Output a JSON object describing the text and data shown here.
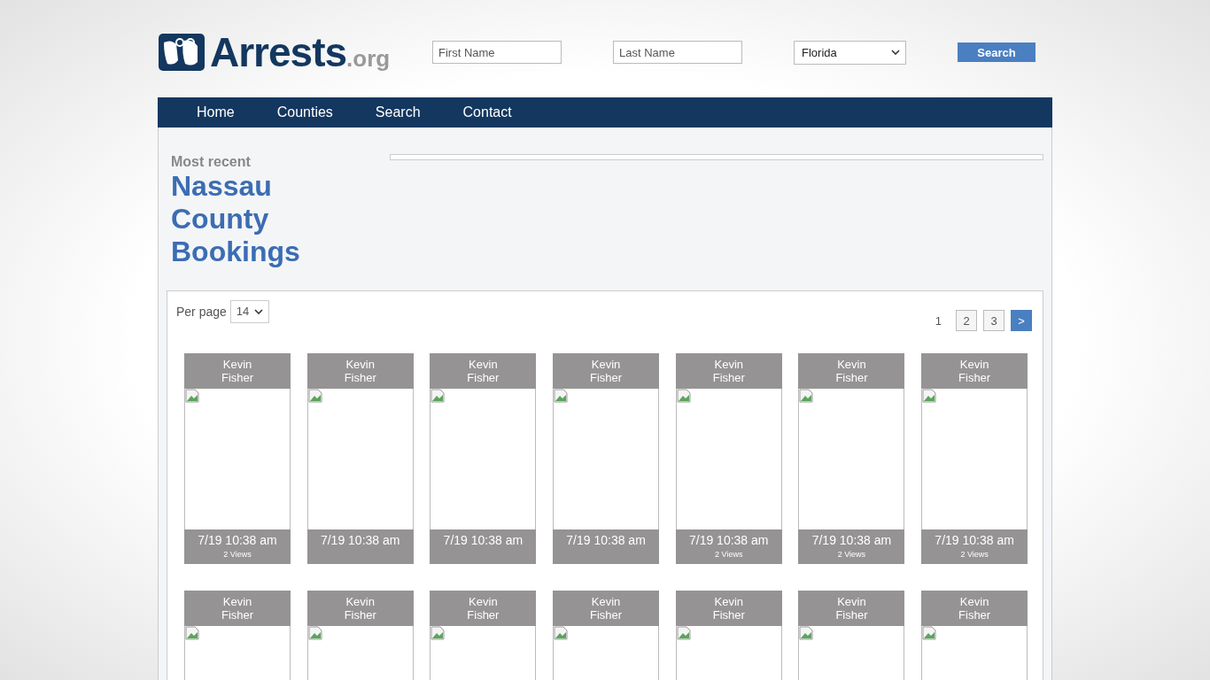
{
  "logo": {
    "name": "Arrests",
    "suffix": ".org"
  },
  "search_form": {
    "first_name": {
      "placeholder": "First Name"
    },
    "last_name": {
      "placeholder": "Last Name"
    },
    "state": "Florida",
    "button": "Search"
  },
  "nav": [
    "Home",
    "Counties",
    "Search",
    "Contact"
  ],
  "heading": {
    "kicker": "Most recent",
    "title": "Nassau County Bookings"
  },
  "per_page": {
    "label": "Per page",
    "value": "14"
  },
  "pagination": [
    {
      "label": "1",
      "kind": "current"
    },
    {
      "label": "2",
      "kind": "page"
    },
    {
      "label": "3",
      "kind": "page"
    },
    {
      "label": ">",
      "kind": "next"
    }
  ],
  "bookings": [
    {
      "first": "Kevin",
      "last": "Fisher",
      "time": "7/19 10:38 am",
      "views": "2 Views"
    },
    {
      "first": "Kevin",
      "last": "Fisher",
      "time": "7/19 10:38 am"
    },
    {
      "first": "Kevin",
      "last": "Fisher",
      "time": "7/19 10:38 am"
    },
    {
      "first": "Kevin",
      "last": "Fisher",
      "time": "7/19 10:38 am"
    },
    {
      "first": "Kevin",
      "last": "Fisher",
      "time": "7/19 10:38 am",
      "views": "2 Views"
    },
    {
      "first": "Kevin",
      "last": "Fisher",
      "time": "7/19 10:38 am",
      "views": "2 Views"
    },
    {
      "first": "Kevin",
      "last": "Fisher",
      "time": "7/19 10:38 am",
      "views": "2 Views"
    },
    {
      "first": "Kevin",
      "last": "Fisher"
    },
    {
      "first": "Kevin",
      "last": "Fisher"
    },
    {
      "first": "Kevin",
      "last": "Fisher"
    },
    {
      "first": "Kevin",
      "last": "Fisher"
    },
    {
      "first": "Kevin",
      "last": "Fisher"
    },
    {
      "first": "Kevin",
      "last": "Fisher"
    },
    {
      "first": "Kevin",
      "last": "Fisher"
    }
  ]
}
